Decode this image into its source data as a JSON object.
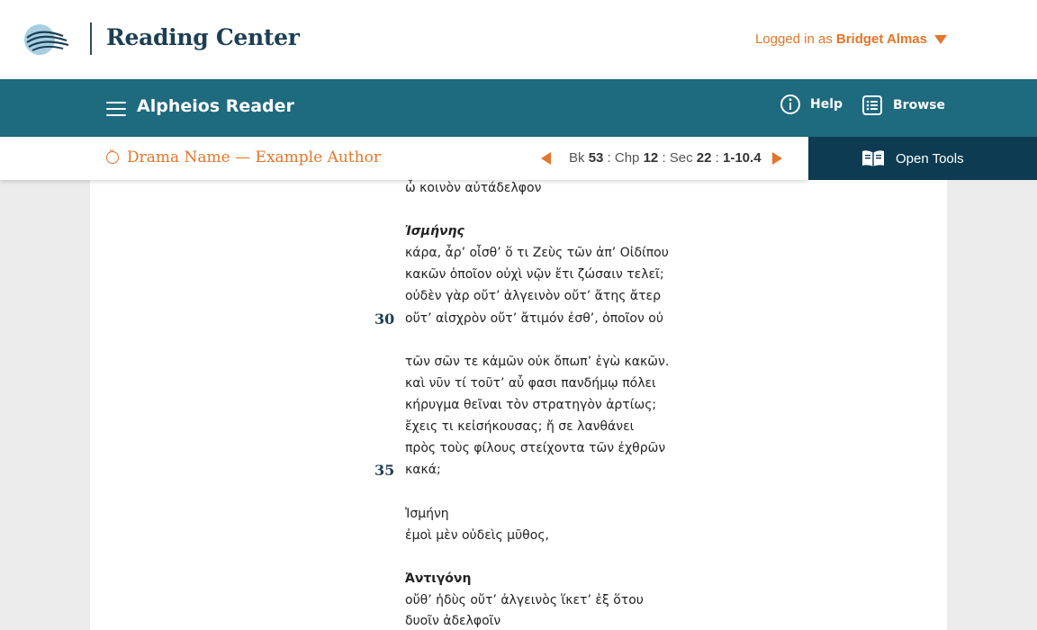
{
  "header": {
    "brand": "Reading Center",
    "logged_in_prefix": "Logged in as",
    "user_name": "Bridget Almas",
    "logo_icon": "alpheios-logo-icon"
  },
  "navbar": {
    "menu_icon": "hamburger-menu-icon",
    "title": "Alpheios Reader",
    "help_label": "Help",
    "browse_label": "Browse"
  },
  "subbar": {
    "work_title": "Drama Name — Example Author",
    "citation": {
      "book_label": "Bk",
      "book": "53",
      "chapter_label": ": Chp",
      "chapter": "12",
      "section_label": ": Sec",
      "section": "22",
      "range_sep": ":",
      "range": "1-10.4"
    },
    "open_tools_label": "Open Tools"
  },
  "text": {
    "lines": [
      "ὦ κοινὸν αὐτάδελφον",
      "Ἰσμήνης",
      "κάρα, ἆρ’ οἶσθ’ ὅ τι Ζεὺς τῶν ἀπ’ Οἰδίπου",
      "κακῶν ὁποῖον οὐχὶ νῷν ἔτι ζώσαιν τελεῖ;",
      "οὐδὲν γὰρ οὔτ’ ἀλγεινὸν οὔτ’ ἄτης ἄτερ",
      "οὔτ’ αἰσχρὸν οὔτ’ ἄτιμόν ἐσθ’, ὁποῖον οὐ",
      "τῶν σῶν τε κἀμῶν οὐκ ὄπωπ’ ἐγὼ κακῶν.",
      "καὶ νῦν τί τοῦτ’ αὖ φασι πανδήμῳ πόλει",
      "κήρυγμα θεῖναι τὸν στρατηγὸν ἀρτίως;",
      "ἔχεις τι κεἰσήκουσας; ἤ σε λανθάνει",
      "πρὸς τοὺς φίλους στείχοντα τῶν ἐχθρῶν",
      "κακά;",
      "Ἰσμήνη",
      "ἐμοὶ μὲν οὐδεὶς μῦθος,",
      "Ἀντιγόνη",
      "οὔθ’ ἡδὺς οὔτ’ ἀλγεινὸς ἵκετ’ ἐξ ὅτου",
      "δυοῖν ἀδελφοῖν"
    ],
    "line_numbers": [
      "30",
      "35"
    ]
  }
}
